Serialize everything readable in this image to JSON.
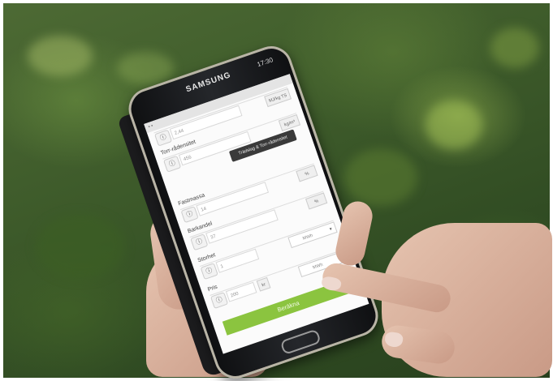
{
  "phone": {
    "brand": "SAMSUNG",
    "status_time": "17:30"
  },
  "app": {
    "fields": [
      {
        "value": "2,44",
        "unit": "MJ/kg TS"
      },
      {
        "label": "Torr-rådensitet",
        "value": "456",
        "unit": "kg/m³"
      },
      {
        "label": "Fastmassa",
        "value": "14",
        "unit": "%"
      },
      {
        "label": "Barkandel",
        "value": "37",
        "unit": "%"
      },
      {
        "label": "Storhet",
        "value": "1",
        "unit": "MWh"
      },
      {
        "label": "Pris",
        "value": "200",
        "unit": "kr",
        "select": "MWh"
      }
    ],
    "tooltip": "Trädslag & Torr-rådensitet",
    "calc_button": "Beräkna"
  },
  "icons": {
    "info": "info-icon",
    "dropdown": "chevron-down-icon"
  }
}
